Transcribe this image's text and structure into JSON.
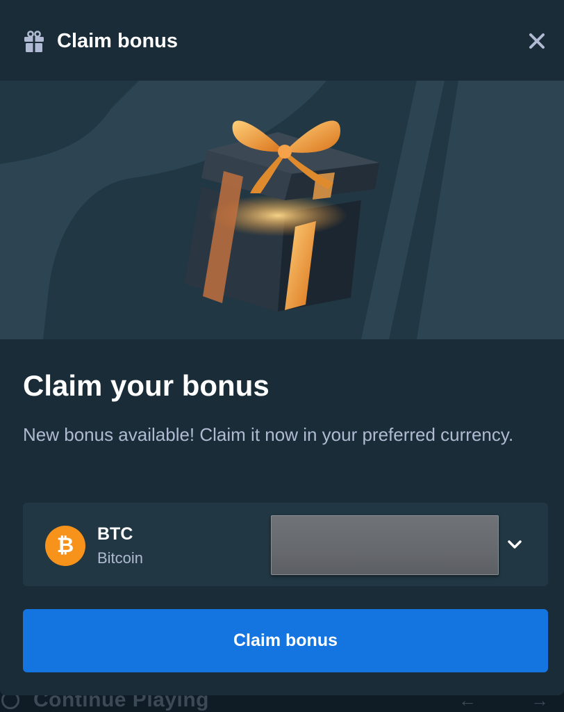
{
  "modal": {
    "title": "Claim bonus",
    "heading": "Claim your bonus",
    "description": "New bonus available! Claim it now in your preferred currency.",
    "icons": {
      "header": "gift-icon",
      "close": "close-icon",
      "dropdown": "chevron-down-icon",
      "currency": "bitcoin-icon"
    }
  },
  "currency_select": {
    "code": "BTC",
    "name": "Bitcoin",
    "symbol": "₿",
    "redacted": true
  },
  "claim_button": {
    "label": "Claim bonus"
  },
  "background": {
    "label": "Continue Playing",
    "prev_arrow": "←",
    "next_arrow": "→"
  },
  "colors": {
    "modal_bg": "#1a2c38",
    "panel_bg": "#213743",
    "accent_blue": "#1475e1",
    "bitcoin_orange": "#f7931a",
    "muted_text": "#b1bad3"
  }
}
